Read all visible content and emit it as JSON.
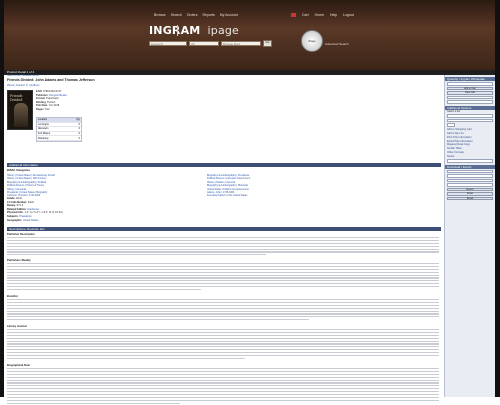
{
  "nav": {
    "items": [
      "Browse",
      "Search",
      "Orders",
      "Reports",
      "My Account"
    ],
    "util": [
      "Home",
      "Help",
      "Logout"
    ],
    "cart_label": "Cart"
  },
  "brand": {
    "name": "INGRAM",
    "product": "ipage"
  },
  "search": {
    "field1_placeholder": "Keyword",
    "field2_placeholder": "All",
    "field3_placeholder": "Browse Dept",
    "go": "Go",
    "advanced": "Advanced Search",
    "badge": "iPage"
  },
  "breadcrumb": "Product Detail 1 of 4",
  "product": {
    "back_link": "Back to List | Related Items",
    "title": "Friends Divided: John Adams and Thomas Jefferson",
    "byline": "Wood, Gordon S. (Author)",
    "cover_title": "Friends Divided",
    "details": [
      {
        "k": "EAN",
        "v": "9780143110477"
      },
      {
        "k": "Publisher",
        "v": "Penguin Books"
      },
      {
        "k": "Format",
        "v": "Paperback"
      },
      {
        "k": "Binding",
        "v": "Perfect"
      },
      {
        "k": "Pub Date",
        "v": "Oct 2018"
      },
      {
        "k": "Pages",
        "v": "512"
      }
    ],
    "price_rows": [
      {
        "a": "Location",
        "b": "Qty"
      },
      {
        "a": "La Vergne",
        "b": "0"
      },
      {
        "a": "Allentown",
        "b": "0"
      },
      {
        "a": "Fort Wayne",
        "b": "0"
      },
      {
        "a": "Roseburg",
        "b": "0"
      }
    ]
  },
  "additional": {
    "header": "Additional Information",
    "bisac_label": "BISAC Categories",
    "categories": [
      "History | United States | Revolutionary Period",
      "Biography & Autobiography | Presidents",
      "History | United States | 19th Century",
      "Political Science | American Government",
      "Biography & Autobiography | Political",
      "History | Modern | General",
      "Political Science | History & Theory",
      "Biography & Autobiography | Historical",
      "History | Americas",
      "United States | Politics and government",
      "Presidents | United States | Biography",
      "Adams, John | 1735-1826",
      "Jefferson, Thomas | 1743-1826",
      "Founding Fathers of the United States"
    ],
    "kv": [
      {
        "k": "Grade",
        "v": "Adult"
      },
      {
        "k": "LC Call Number",
        "v": "E322"
      },
      {
        "k": "Dewey",
        "v": "973.4"
      },
      {
        "k": "Related Edition",
        "v": "Hardcover"
      },
      {
        "k": "Physical Info",
        "v": "1.2\" H x 5.4\" L x 8.4\" W (1.15 lbs)"
      },
      {
        "k": "Subjects",
        "v": "Presidents"
      },
      {
        "k": "Geographic",
        "v": "United States"
      }
    ]
  },
  "description": {
    "header": "Descriptions, Reviews, Etc.",
    "para_labels": [
      "Publisher Description",
      "Publishers Weekly",
      "Booklist",
      "Library Journal"
    ],
    "last_label": "Biographical Note"
  },
  "sidebar": {
    "order_header": "Quantity / Ingram Wholesale",
    "add_button": "Add to Cart",
    "view_button": "View Cart",
    "list_header": "Additional Options",
    "list_label": "Select a list",
    "links": [
      "Add to Shopping Cart",
      "Add to My List",
      "Print Title Information",
      "Email Title Information",
      "Request Desk Copy",
      "Similar Titles",
      "Other Formats",
      "Series"
    ],
    "lookup_header": "Download / Export",
    "actions": [
      "Export",
      "Excel",
      "Email"
    ]
  },
  "colors": {
    "brand_bg": "#4a2e20",
    "nav_header": "#3d4f75",
    "link": "#2a55a8"
  }
}
